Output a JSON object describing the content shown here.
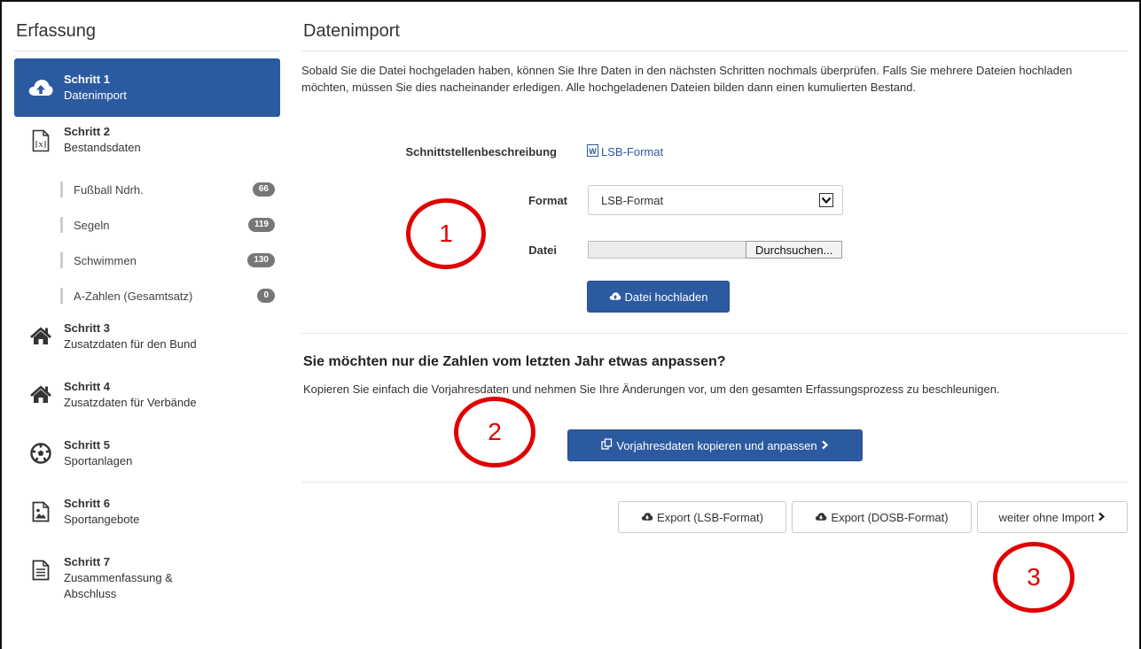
{
  "sidebar": {
    "title": "Erfassung",
    "steps": [
      {
        "num": "Schritt 1",
        "name": "Datenimport",
        "icon": "cloud-upload-icon"
      },
      {
        "num": "Schritt 2",
        "name": "Bestandsdaten",
        "icon": "excel-file-icon"
      },
      {
        "num": "Schritt 3",
        "name": "Zusatzdaten für den Bund",
        "icon": "home-icon"
      },
      {
        "num": "Schritt 4",
        "name": "Zusatzdaten für Verbände",
        "icon": "home-icon"
      },
      {
        "num": "Schritt 5",
        "name": "Sportanlagen",
        "icon": "soccer-ball-icon"
      },
      {
        "num": "Schritt 6",
        "name": "Sportangebote",
        "icon": "image-file-icon"
      },
      {
        "num": "Schritt 7",
        "name": "Zusammenfassung & Abschluss",
        "icon": "document-icon"
      }
    ],
    "subitems": [
      {
        "label": "Fußball Ndrh.",
        "count": "66"
      },
      {
        "label": "Segeln",
        "count": "119"
      },
      {
        "label": "Schwimmen",
        "count": "130"
      },
      {
        "label": "A-Zahlen (Gesamtsatz)",
        "count": "0"
      }
    ]
  },
  "main": {
    "title": "Datenimport",
    "intro": "Sobald Sie die Datei hochgeladen haben, können Sie Ihre Daten in den nächsten Schritten nochmals überprüfen. Falls Sie mehrere Dateien hochladen möchten, müssen Sie dies nacheinander erledigen. Alle hochgeladenen Dateien bilden dann einen kumulierten Bestand.",
    "schnittstelle_label": "Schnittstellenbeschreibung",
    "schnittstelle_link": "LSB-Format",
    "format_label": "Format",
    "format_value": "LSB-Format",
    "datei_label": "Datei",
    "browse_label": "Durchsuchen...",
    "upload_label": "Datei hochladen",
    "section2_title": "Sie möchten nur die Zahlen vom letzten Jahr etwas anpassen?",
    "section2_text": "Kopieren Sie einfach die Vorjahresdaten und nehmen Sie Ihre Änderungen vor, um den gesamten Erfassungsprozess zu beschleunigen.",
    "copy_button": "Vorjahresdaten kopieren und anpassen",
    "export_lsb": "Export (LSB-Format)",
    "export_dosb": "Export (DOSB-Format)",
    "continue_button": "weiter ohne Import"
  },
  "annotations": [
    "1",
    "2",
    "3"
  ],
  "colors": {
    "primary": "#2c5aa0",
    "annotation": "#e00000",
    "badge": "#777777"
  }
}
